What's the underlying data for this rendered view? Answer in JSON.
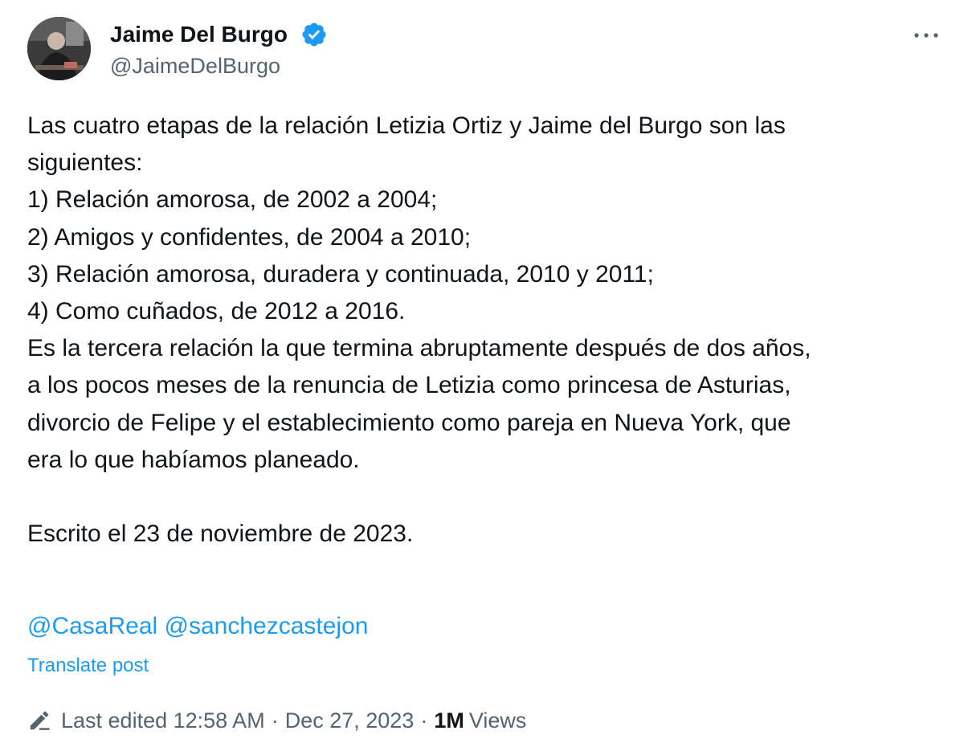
{
  "author": {
    "display_name": "Jaime Del Burgo",
    "handle": "@JaimeDelBurgo",
    "verified": true,
    "avatar_icon": "user-photo"
  },
  "menu_icon": "more-horizontal-icon",
  "post": {
    "lines": [
      "Las cuatro etapas de la relación Letizia Ortiz y Jaime del Burgo son las",
      "siguientes:",
      "1) Relación amorosa, de 2002 a 2004;",
      "2) Amigos y confidentes, de 2004 a 2010;",
      "3) Relación amorosa, duradera y continuada, 2010 y 2011;",
      "4) Como cuñados, de 2012 a 2016.",
      "Es la tercera relación la que termina abruptamente después de dos años,",
      "a los pocos meses de la renuncia de Letizia como princesa de Asturias,",
      "divorcio de Felipe y el establecimiento como pareja en Nueva York, que",
      "era lo que habíamos planeado.",
      "",
      "Escrito el 23 de noviembre de 2023."
    ],
    "mentions": [
      "@CasaReal",
      "@sanchezcastejon"
    ]
  },
  "translate_label": "Translate post",
  "meta": {
    "edited_label": "Last edited 12:58 AM",
    "separator": "·",
    "date": "Dec 27, 2023",
    "views_count": "1M",
    "views_label": "Views"
  },
  "colors": {
    "accent": "#1d9bf0",
    "text": "#0f1419",
    "secondary": "#536471"
  }
}
